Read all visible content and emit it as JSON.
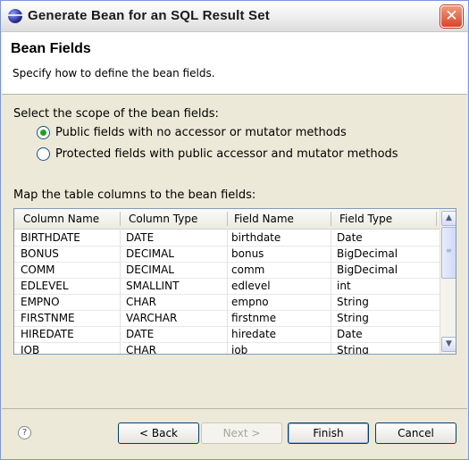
{
  "window": {
    "title": "Generate Bean for an SQL Result Set",
    "close_glyph": "✕"
  },
  "header": {
    "title": "Bean Fields",
    "description": "Specify how to define the bean fields."
  },
  "scope": {
    "label": "Select the scope of the bean fields:",
    "options": [
      {
        "label": "Public fields with no accessor or mutator methods",
        "selected": true
      },
      {
        "label": "Protected fields with public accessor and mutator methods",
        "selected": false
      }
    ]
  },
  "mapping": {
    "label": "Map the table columns to the bean fields:",
    "columns": [
      "Column Name",
      "Column Type",
      "Field Name",
      "Field Type"
    ],
    "rows": [
      [
        "BIRTHDATE",
        "DATE",
        "birthdate",
        "Date"
      ],
      [
        "BONUS",
        "DECIMAL",
        "bonus",
        "BigDecimal"
      ],
      [
        "COMM",
        "DECIMAL",
        "comm",
        "BigDecimal"
      ],
      [
        "EDLEVEL",
        "SMALLINT",
        "edlevel",
        "int"
      ],
      [
        "EMPNO",
        "CHAR",
        "empno",
        "String"
      ],
      [
        "FIRSTNME",
        "VARCHAR",
        "firstnme",
        "String"
      ],
      [
        "HIREDATE",
        "DATE",
        "hiredate",
        "Date"
      ],
      [
        "JOB",
        "CHAR",
        "job",
        "String"
      ]
    ]
  },
  "footer": {
    "help_glyph": "?",
    "back_label": "< Back",
    "next_label": "Next >",
    "finish_label": "Finish",
    "cancel_label": "Cancel"
  }
}
